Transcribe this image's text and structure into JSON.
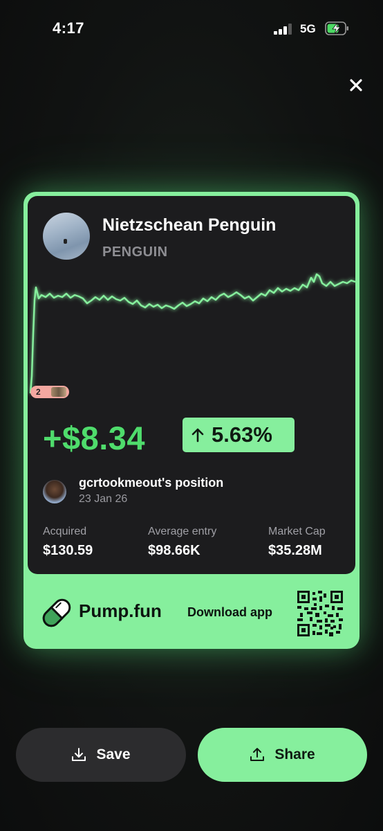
{
  "status_bar": {
    "time": "4:17",
    "network": "5G"
  },
  "card": {
    "token_name": "Nietzschean Penguin",
    "token_ticker": "PENGUIN",
    "chart_badge": "2",
    "pnl": "+$8.34",
    "pnl_percent": "5.63%",
    "user_position": "gcrtookmeout's position",
    "date": "23 Jan 26",
    "stats": [
      {
        "label": "Acquired",
        "value": "$130.59"
      },
      {
        "label": "Average entry",
        "value": "$98.66K"
      },
      {
        "label": "Market Cap",
        "value": "$35.28M"
      }
    ],
    "brand": "Pump.fun",
    "download": "Download app"
  },
  "buttons": {
    "save": "Save",
    "share": "Share"
  },
  "colors": {
    "accent": "#86ef9d",
    "positive": "#4fdc6c",
    "card_bg": "#1c1c1e",
    "button_dark": "#2c2c2e"
  }
}
